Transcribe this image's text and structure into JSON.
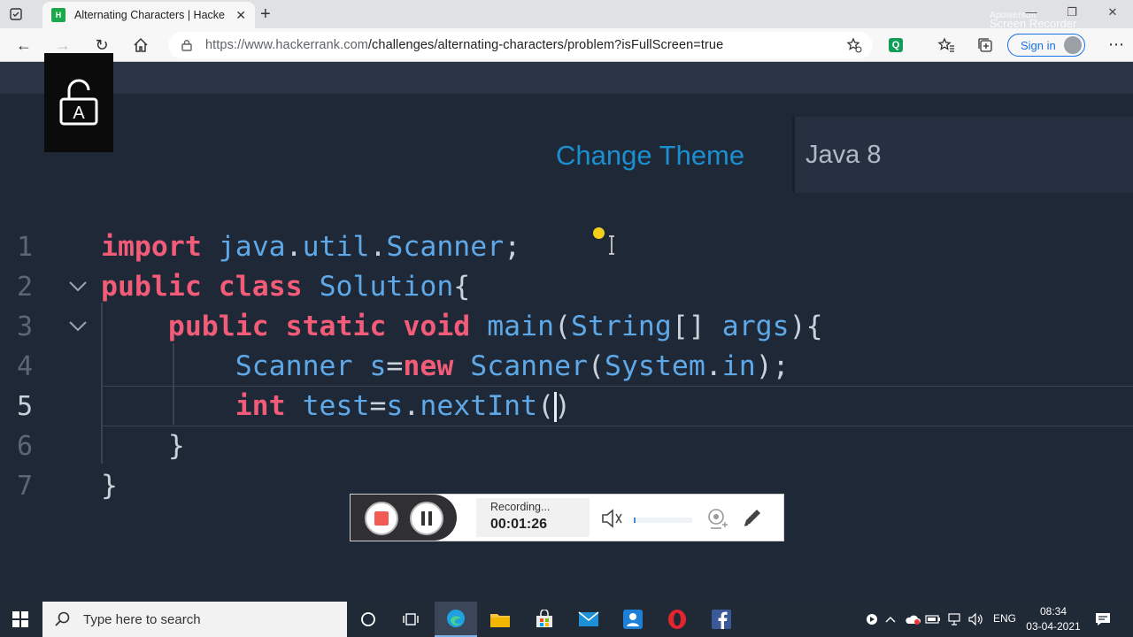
{
  "browser": {
    "tab_title": "Alternating Characters | HackerRank",
    "favicon_text": "H",
    "url_host": "https://www.hackerrank.com",
    "url_path": "/challenges/alternating-characters/problem?isFullScreen=true",
    "sign_in_label": "Sign in",
    "extension_letter": "Q"
  },
  "watermark": {
    "line1": "Apowersoft",
    "line2": "Screen Recorder"
  },
  "editor": {
    "change_theme_label": "Change Theme",
    "language_selected": "Java 8",
    "line_numbers": [
      "1",
      "2",
      "3",
      "4",
      "5",
      "6",
      "7"
    ]
  },
  "recorder": {
    "status_label": "Recording...",
    "elapsed_time": "00:01:26"
  },
  "taskbar": {
    "search_placeholder": "Type here to search",
    "language": "ENG",
    "time": "08:34",
    "date": "03-04-2021"
  },
  "colors": {
    "editor_bg": "#1e2836",
    "keyword": "#f25c78",
    "identifier": "#5fa8e8",
    "link_accent": "#1b8fd0",
    "recorder_stop": "#f25c55"
  }
}
